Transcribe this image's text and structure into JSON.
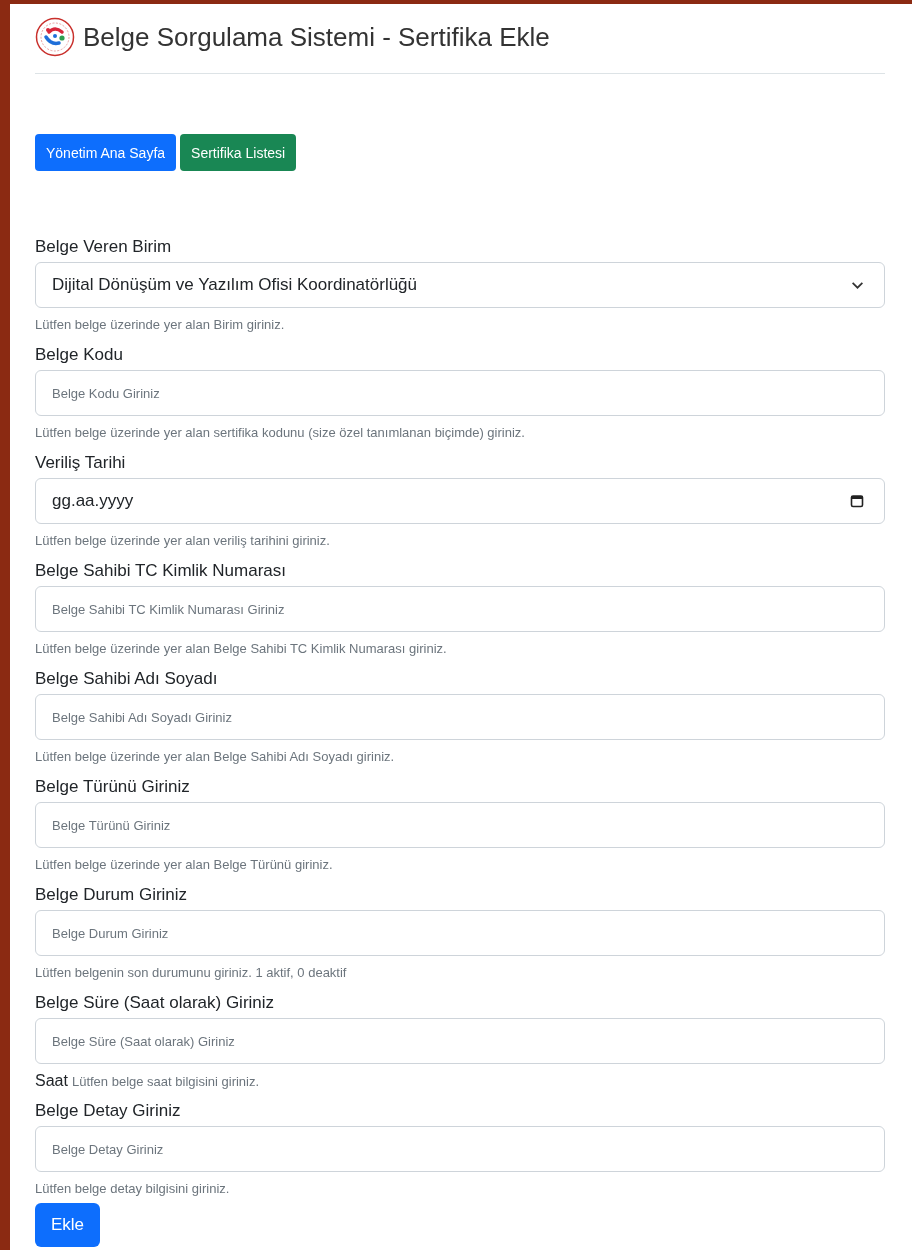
{
  "header": {
    "title": "Belge Sorgulama Sistemi - Sertifika Ekle"
  },
  "nav_buttons": [
    {
      "label": "Yönetim Ana Sayfa",
      "kind": "primary"
    },
    {
      "label": "Sertifika Listesi",
      "kind": "success"
    }
  ],
  "fields": [
    {
      "kind": "select",
      "label": "Belge Veren Birim",
      "value": "Dijital Dönüşüm ve Yazılım Ofisi Koordinatörlüğü",
      "help": "Lütfen belge üzerinde yer alan Birim giriniz."
    },
    {
      "kind": "text",
      "label": "Belge Kodu",
      "placeholder": "Belge Kodu Giriniz",
      "help": "Lütfen belge üzerinde yer alan sertifika kodunu (size özel tanımlanan biçimde) giriniz."
    },
    {
      "kind": "date",
      "label": "Veriliş Tarihi",
      "value": "gg.aa.yyyy",
      "help": "Lütfen belge üzerinde yer alan veriliş tarihini giriniz."
    },
    {
      "kind": "text",
      "label": "Belge Sahibi TC Kimlik Numarası",
      "placeholder": "Belge Sahibi TC Kimlik Numarası Giriniz",
      "help": "Lütfen belge üzerinde yer alan Belge Sahibi TC Kimlik Numarası giriniz."
    },
    {
      "kind": "text",
      "label": "Belge Sahibi Adı Soyadı",
      "placeholder": "Belge Sahibi Adı Soyadı Giriniz",
      "help": "Lütfen belge üzerinde yer alan Belge Sahibi Adı Soyadı giriniz."
    },
    {
      "kind": "text",
      "label": "Belge Türünü Giriniz",
      "placeholder": "Belge Türünü Giriniz",
      "help": "Lütfen belge üzerinde yer alan Belge Türünü giriniz."
    },
    {
      "kind": "text",
      "label": "Belge Durum Giriniz",
      "placeholder": "Belge Durum Giriniz",
      "help": "Lütfen belgenin son durumunu giriniz. 1 aktif, 0 deaktif"
    },
    {
      "kind": "text",
      "label": "Belge Süre (Saat olarak) Giriniz",
      "placeholder": "Belge Süre (Saat olarak) Giriniz",
      "unit": "Saat",
      "help": "Lütfen belge saat bilgisini giriniz."
    },
    {
      "kind": "text",
      "label": "Belge Detay Giriniz",
      "placeholder": "Belge Detay Giriniz",
      "help": "Lütfen belge detay bilgisini giriniz."
    }
  ],
  "submit_button": {
    "label": "Ekle"
  }
}
